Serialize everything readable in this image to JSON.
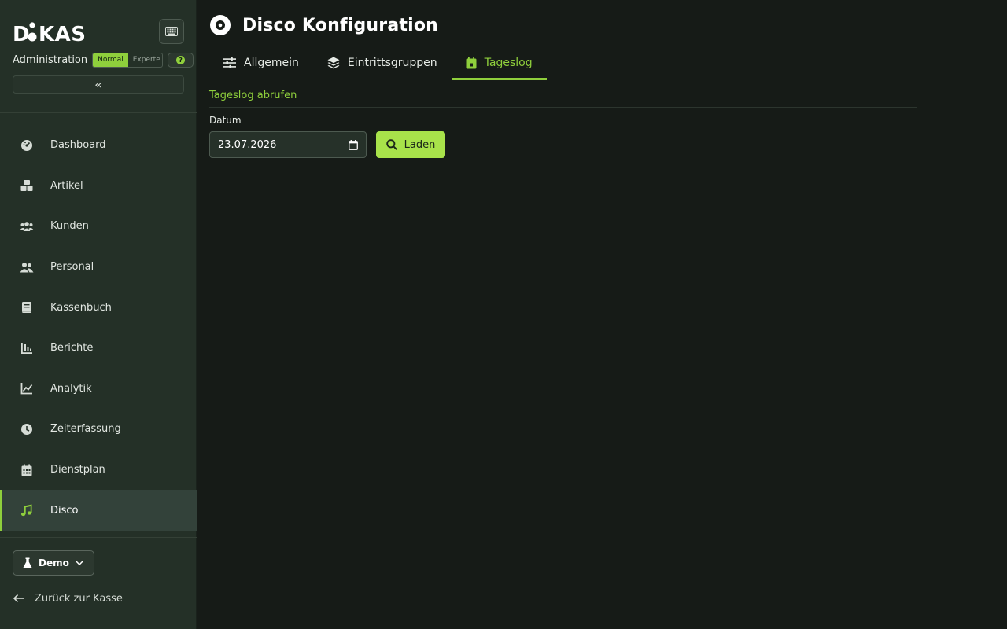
{
  "app": {
    "logo_text": "DiKAS",
    "section_label": "Administration",
    "mode_options": [
      "Normal",
      "Experte"
    ],
    "active_mode": "Normal",
    "help_label": "?",
    "collapse_glyph": "«"
  },
  "sidebar": {
    "items": [
      {
        "label": "Dashboard",
        "icon": "dashboard-icon"
      },
      {
        "label": "Artikel",
        "icon": "boxes-icon"
      },
      {
        "label": "Kunden",
        "icon": "users-group-icon"
      },
      {
        "label": "Personal",
        "icon": "staff-icon"
      },
      {
        "label": "Kassenbuch",
        "icon": "book-icon"
      },
      {
        "label": "Berichte",
        "icon": "bar-chart-icon"
      },
      {
        "label": "Analytik",
        "icon": "line-chart-icon"
      },
      {
        "label": "Zeiterfassung",
        "icon": "clock-icon"
      },
      {
        "label": "Dienstplan",
        "icon": "calendar-icon"
      },
      {
        "label": "Disco",
        "icon": "music-note-icon"
      }
    ],
    "active_item": "Disco",
    "environment_label": "Demo",
    "back_label": "Zurück zur Kasse"
  },
  "page": {
    "title": "Disco Konfiguration",
    "tabs": [
      {
        "label": "Allgemein",
        "icon": "sliders-icon"
      },
      {
        "label": "Eintrittsgruppen",
        "icon": "layers-icon"
      },
      {
        "label": "Tageslog",
        "icon": "calendar-day-icon"
      }
    ],
    "active_tab": "Tageslog",
    "section_title": "Tageslog abrufen",
    "date_label": "Datum",
    "date_value": "23.07.2026",
    "load_button": "Laden"
  },
  "colors": {
    "accent": "#8fcf3c",
    "button": "#a8e24a",
    "sidebar_bg": "#243027",
    "main_bg": "#161b17"
  }
}
